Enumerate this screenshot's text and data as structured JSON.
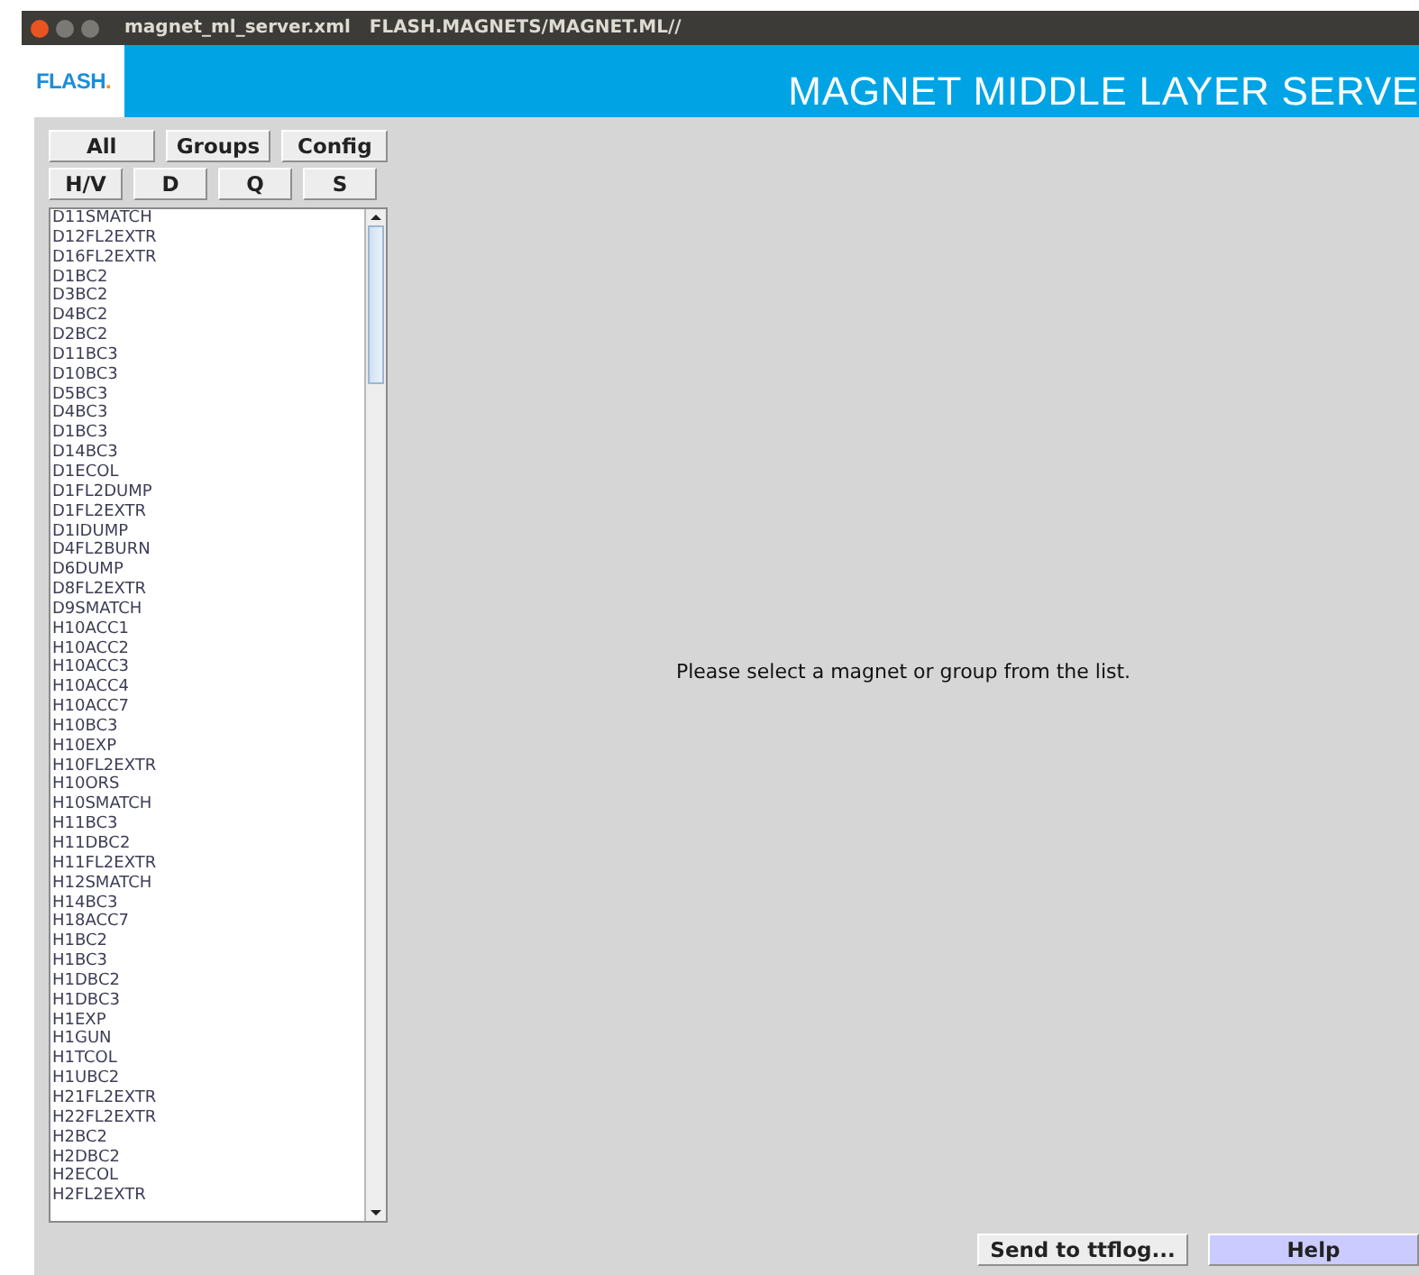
{
  "window": {
    "title": "magnet_ml_server.xml   FLASH.MAGNETS/MAGNET.ML//"
  },
  "header": {
    "logo": "FLASH",
    "logo_dot": ".",
    "title": "MAGNET MIDDLE LAYER SERVE"
  },
  "filter_buttons": [
    [
      "All",
      "Groups",
      "Config"
    ],
    [
      "H/V",
      "D",
      "Q",
      "S"
    ]
  ],
  "magnet_list": [
    "D11SMATCH",
    "D12FL2EXTR",
    "D16FL2EXTR",
    "D1BC2",
    "D3BC2",
    "D4BC2",
    "D2BC2",
    "D11BC3",
    "D10BC3",
    "D5BC3",
    "D4BC3",
    "D1BC3",
    "D14BC3",
    "D1ECOL",
    "D1FL2DUMP",
    "D1FL2EXTR",
    "D1IDUMP",
    "D4FL2BURN",
    "D6DUMP",
    "D8FL2EXTR",
    "D9SMATCH",
    "H10ACC1",
    "H10ACC2",
    "H10ACC3",
    "H10ACC4",
    "H10ACC7",
    "H10BC3",
    "H10EXP",
    "H10FL2EXTR",
    "H10ORS",
    "H10SMATCH",
    "H11BC3",
    "H11DBC2",
    "H11FL2EXTR",
    "H12SMATCH",
    "H14BC3",
    "H18ACC7",
    "H1BC2",
    "H1BC3",
    "H1DBC2",
    "H1DBC3",
    "H1EXP",
    "H1GUN",
    "H1TCOL",
    "H1UBC2",
    "H21FL2EXTR",
    "H22FL2EXTR",
    "H2BC2",
    "H2DBC2",
    "H2ECOL",
    "H2FL2EXTR"
  ],
  "message": "Please select a magnet or group from the list.",
  "bottom_buttons": [
    {
      "label": "Send to ttflog...",
      "kind": "plain"
    },
    {
      "label": "Help",
      "kind": "highlight"
    }
  ]
}
